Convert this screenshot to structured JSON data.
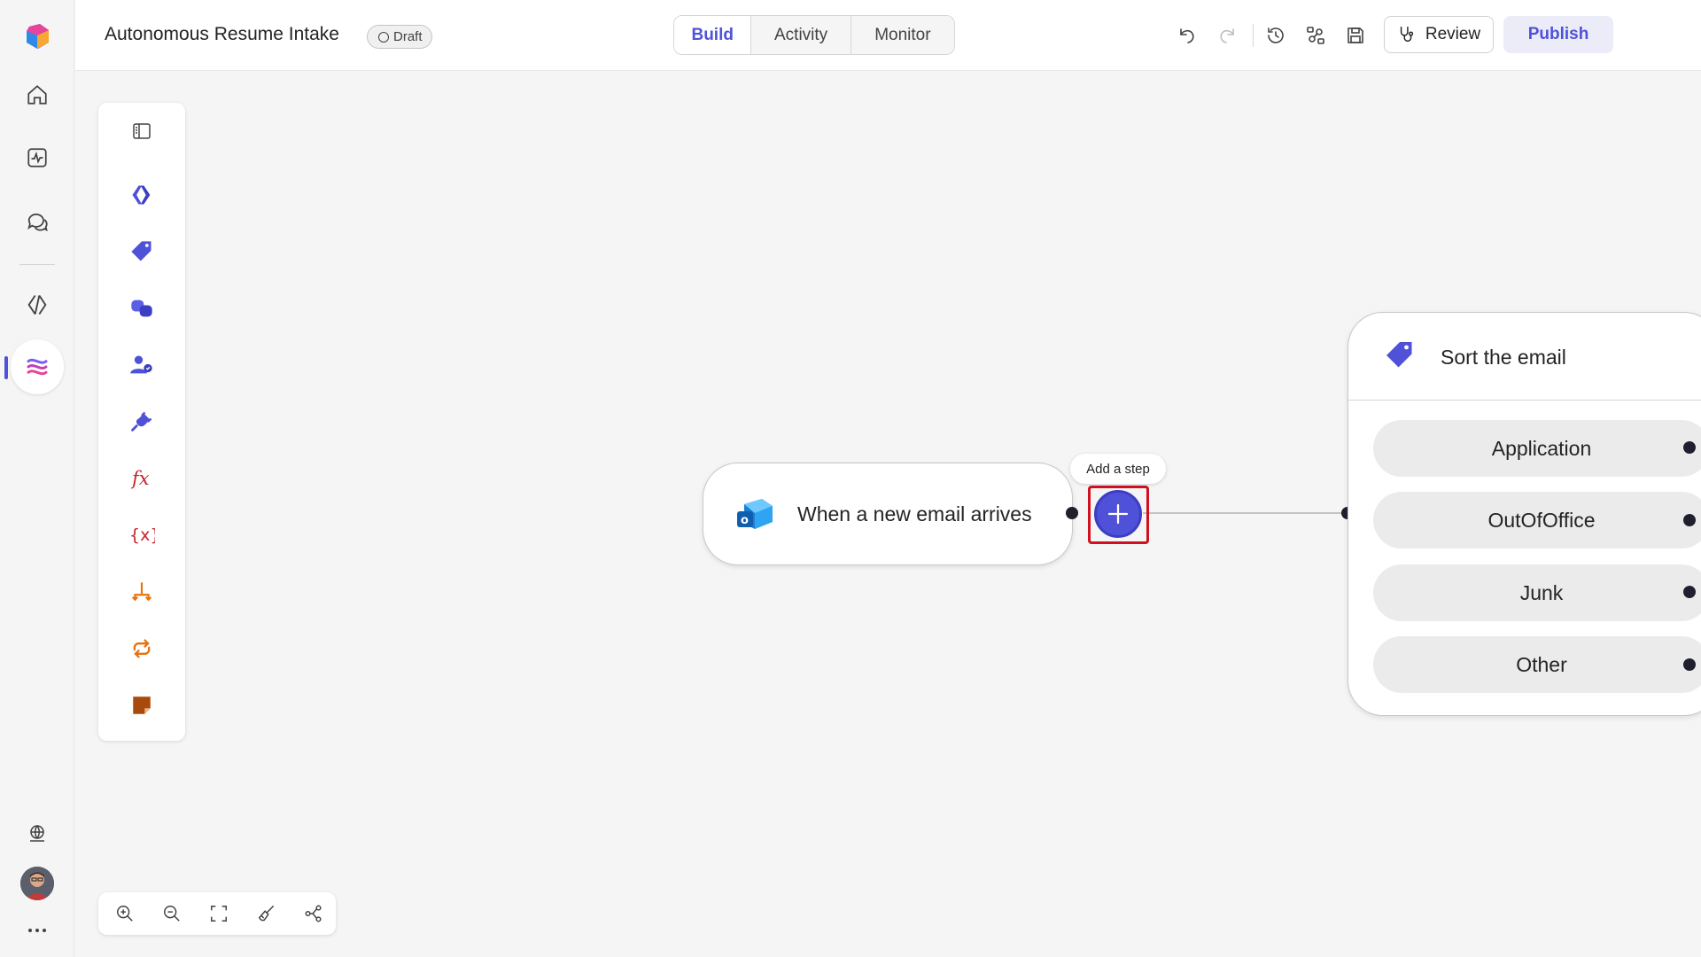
{
  "header": {
    "title": "Autonomous Resume Intake",
    "status_badge": "Draft",
    "tabs": [
      {
        "label": "Build",
        "active": true
      },
      {
        "label": "Activity",
        "active": false
      },
      {
        "label": "Monitor",
        "active": false
      }
    ],
    "review_label": "Review",
    "publish_label": "Publish"
  },
  "canvas": {
    "trigger_node": {
      "label": "When a new email arrives",
      "icon": "outlook-icon"
    },
    "add_step_tooltip": "Add a step",
    "sort_node": {
      "title": "Sort the email",
      "icon": "tag-icon",
      "options": [
        "Application",
        "OutOfOffice",
        "Junk",
        "Other"
      ]
    }
  },
  "colors": {
    "accent": "#4f52d9",
    "highlight_box": "#d20f1e",
    "fx_red": "#c4262e",
    "orange": "#e8730c"
  }
}
